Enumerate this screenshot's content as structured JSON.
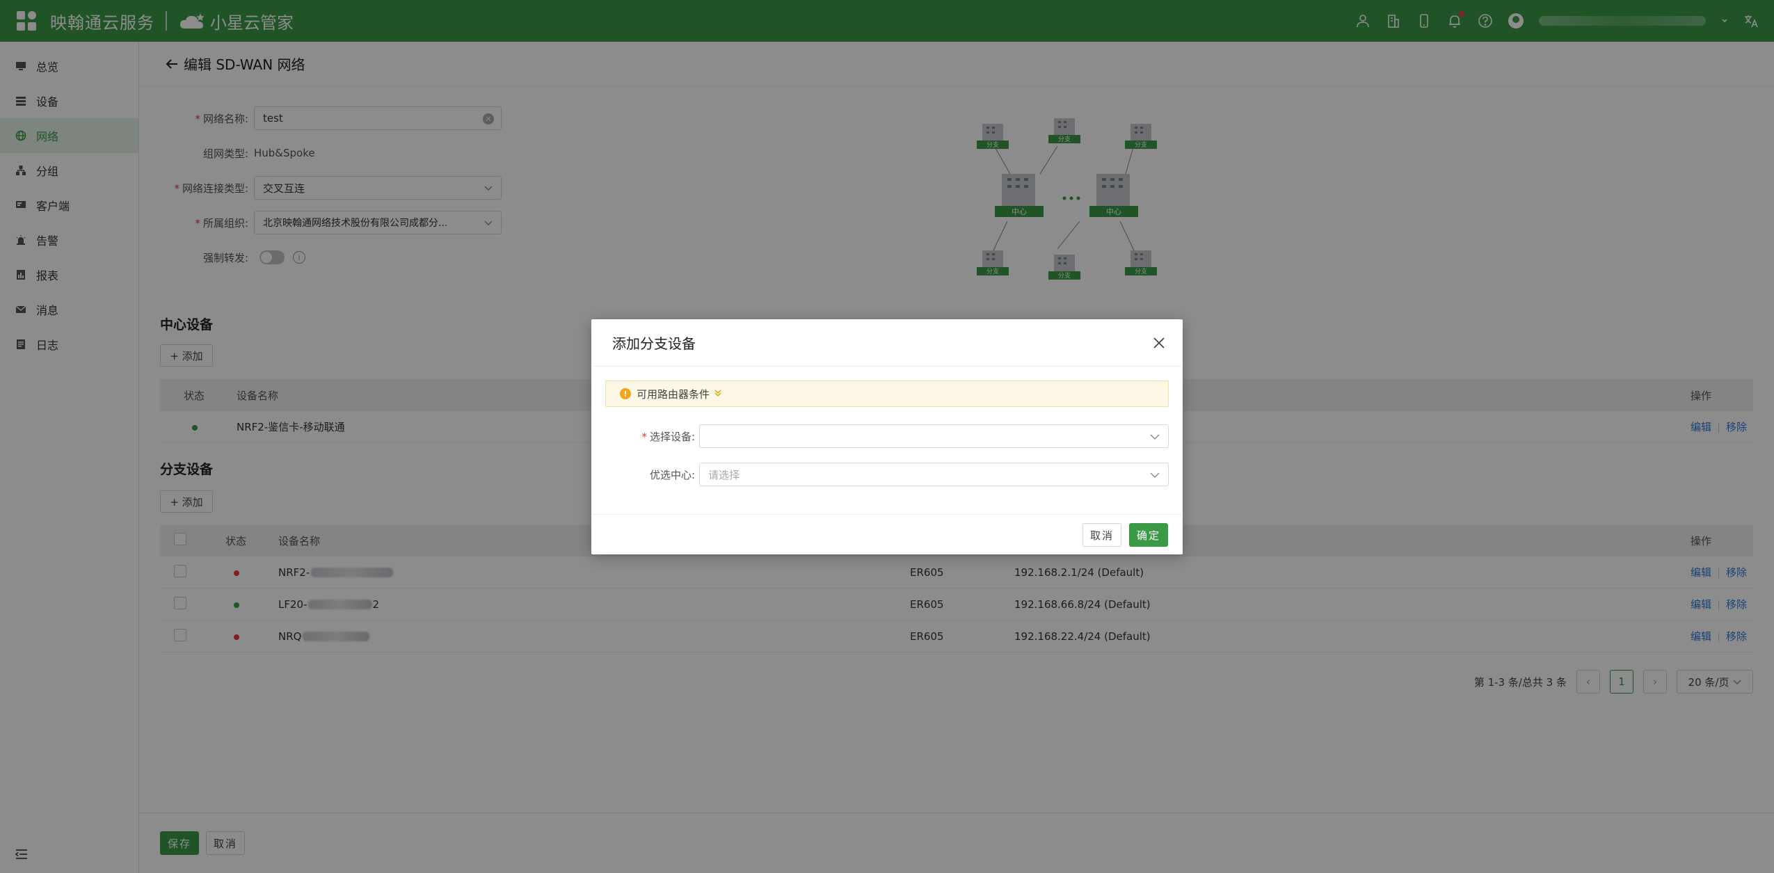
{
  "topbar": {
    "brand": "映翰通云服务",
    "product": "小星云管家"
  },
  "sidebar": {
    "items": [
      {
        "label": "总览",
        "icon": "monitor-icon"
      },
      {
        "label": "设备",
        "icon": "device-list-icon"
      },
      {
        "label": "网络",
        "icon": "globe-icon",
        "active": true
      },
      {
        "label": "分组",
        "icon": "group-tree-icon"
      },
      {
        "label": "客户端",
        "icon": "client-icon"
      },
      {
        "label": "告警",
        "icon": "alarm-icon"
      },
      {
        "label": "报表",
        "icon": "report-icon"
      },
      {
        "label": "消息",
        "icon": "message-icon"
      },
      {
        "label": "日志",
        "icon": "log-icon"
      }
    ]
  },
  "page": {
    "title": "编辑 SD-WAN 网络"
  },
  "form": {
    "name_label": "网络名称:",
    "name_value": "test",
    "type_label": "组网类型:",
    "type_value": "Hub&Spoke",
    "conn_label": "网络连接类型:",
    "conn_value": "交叉互连",
    "org_label": "所属组织:",
    "org_value": "北京映翰通网络技术股份有限公司成都分...",
    "force_label": "强制转发:"
  },
  "topology": {
    "branch_label": "分支",
    "hub_label": "中心"
  },
  "hub_section": {
    "title": "中心设备",
    "add": "+ 添加",
    "columns": {
      "status": "状态",
      "name": "设备名称",
      "ops": "操作"
    },
    "rows": [
      {
        "name": "NRF2-鉴信卡-移动联通",
        "status": "online"
      }
    ]
  },
  "branch_section": {
    "title": "分支设备",
    "add": "+ 添加",
    "columns": {
      "status": "状态",
      "name": "设备名称",
      "ops": "操作"
    },
    "rows": [
      {
        "name_prefix": "NRF2-",
        "model": "ER605",
        "subnet": "192.168.2.1/24 (Default)",
        "status": "offline"
      },
      {
        "name_prefix": "LF20-",
        "name_suffix": "2",
        "model": "ER605",
        "subnet": "192.168.66.8/24 (Default)",
        "status": "online"
      },
      {
        "name_prefix": "NRQ",
        "model": "ER605",
        "subnet": "192.168.22.4/24 (Default)",
        "status": "offline"
      }
    ]
  },
  "ops": {
    "edit": "编辑",
    "remove": "移除"
  },
  "pagination": {
    "summary": "第 1-3 条/总共 3 条",
    "current": "1",
    "page_size": "20 条/页"
  },
  "footer": {
    "save": "保存",
    "cancel": "取消"
  },
  "modal": {
    "title": "添加分支设备",
    "tip": "可用路由器条件",
    "device_label": "选择设备:",
    "device_value": "",
    "hub_label": "优选中心:",
    "hub_placeholder": "请选择",
    "cancel": "取消",
    "confirm": "确定"
  },
  "colors": {
    "brand_green": "#3b9a45",
    "link_blue": "#2f79d9",
    "online": "#3b9a45",
    "offline": "#e53935",
    "warning": "#f2a41a"
  }
}
